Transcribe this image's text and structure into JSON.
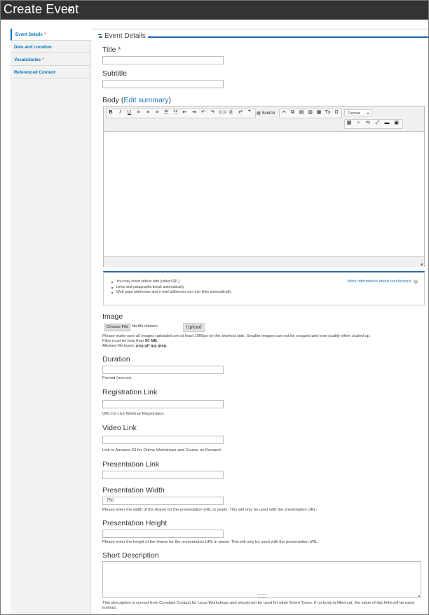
{
  "header": {
    "title": "Create Event",
    "title_icon": "circle-plus-icon"
  },
  "sidebar": {
    "tabs": [
      {
        "label": "Event Details",
        "required": "*"
      },
      {
        "label": "Date and Location",
        "required": ""
      },
      {
        "label": "Vocabularies",
        "required": "*"
      },
      {
        "label": "Referenced Content",
        "required": ""
      }
    ]
  },
  "fieldset": {
    "legend": "Event Details"
  },
  "fields": {
    "title": {
      "label": "Title",
      "required": "*",
      "value": ""
    },
    "subtitle": {
      "label": "Subtitle",
      "value": ""
    },
    "body": {
      "label": "Body",
      "label_open": "(",
      "summary_link": "Edit summary",
      "label_close": ")"
    },
    "editor": {
      "toolbar_buttons": [
        {
          "name": "bold-icon",
          "glyph": "B"
        },
        {
          "name": "italic-icon",
          "glyph": "I"
        },
        {
          "name": "underline-icon",
          "glyph": "U"
        },
        {
          "name": "align-left-icon",
          "glyph": "≡"
        },
        {
          "name": "align-center-icon",
          "glyph": "≡"
        },
        {
          "name": "align-right-icon",
          "glyph": "≡"
        },
        {
          "name": "bulleted-list-icon",
          "glyph": "☰"
        },
        {
          "name": "numbered-list-icon",
          "glyph": "☷"
        },
        {
          "name": "outdent-icon",
          "glyph": "⇤"
        },
        {
          "name": "indent-icon",
          "glyph": "⇥"
        },
        {
          "name": "undo-icon",
          "glyph": "↶"
        },
        {
          "name": "redo-icon",
          "glyph": "↷"
        },
        {
          "name": "link-icon",
          "glyph": "⊂⊃"
        },
        {
          "name": "unlink-icon",
          "glyph": "⊄"
        },
        {
          "name": "superscript-icon",
          "glyph": "x²"
        },
        {
          "name": "blockquote-icon",
          "glyph": "❞"
        }
      ],
      "source_label": "Source",
      "source_icon": "source-icon",
      "toolbar_buttons_2": [
        {
          "name": "cut-icon",
          "glyph": "✂"
        },
        {
          "name": "copy-icon",
          "glyph": "⧉"
        },
        {
          "name": "paste-icon",
          "glyph": "▤"
        },
        {
          "name": "paste-text-icon",
          "glyph": "▥"
        },
        {
          "name": "paste-word-icon",
          "glyph": "▦"
        },
        {
          "name": "remove-format-icon",
          "glyph": "Tx"
        },
        {
          "name": "special-char-icon",
          "glyph": "Ω"
        }
      ],
      "format_label": "Format",
      "toolbar_row2": [
        {
          "name": "table-icon",
          "glyph": "▦"
        },
        {
          "name": "find-icon",
          "glyph": "⌕"
        },
        {
          "name": "replace-icon",
          "glyph": "⇆"
        },
        {
          "name": "maximize-icon",
          "glyph": "⤢"
        },
        {
          "name": "horizontal-rule-icon",
          "glyph": "▬"
        },
        {
          "name": "image-icon",
          "glyph": "▣"
        }
      ]
    },
    "text_format": {
      "tips": [
        "You may insert videos with [video:URL]",
        "Lines and paragraphs break automatically.",
        "Web page addresses and e-mail addresses turn into links automatically."
      ],
      "more_info": "More information about text formats",
      "help_icon": "?"
    },
    "image": {
      "label": "Image",
      "choose_file": "Choose File",
      "no_file": "No file chosen",
      "upload": "Upload",
      "help_1": "Please make sure all images uploaded are at least 1000px on the shortest side. Smaller images can not be cropped and lose quality when scaled up.",
      "help_2_prefix": "Files must be less than ",
      "help_2_value": "50 MB",
      "help_2_suffix": ".",
      "help_3_prefix": "Allowed file types: ",
      "help_3_value": "png gif jpg jpeg",
      "help_3_suffix": "."
    },
    "duration": {
      "label": "Duration",
      "value": "",
      "help": "Format (mm:ss)."
    },
    "registration_link": {
      "label": "Registration Link",
      "value": "",
      "help": "URL for Live Webinar Registration."
    },
    "video_link": {
      "label": "Video Link",
      "value": "",
      "help": "Link to Amazon S3 for Online Workshops and Course on Demand."
    },
    "presentation_link": {
      "label": "Presentation Link",
      "value": ""
    },
    "presentation_width": {
      "label": "Presentation Width",
      "value": "750",
      "help": "Please enter the width of the iframe for the presentation URL in pixels. This will only be used with the presentation URL."
    },
    "presentation_height": {
      "label": "Presentation Height",
      "value": "",
      "help": "Please enter the height of the iframe for the presentation URL in pixels. This will only be used with the presentation URL."
    },
    "short_description": {
      "label": "Short Description",
      "value": "",
      "help": "This description is synced from Constant Contact for Local Workshops and should not be used for other Event Types. If no body is filled out, the value of this field will be used instead."
    }
  },
  "colors": {
    "header_bg": "#333333",
    "accent": "#1c6ab5",
    "link": "#1e75c1",
    "required": "#e0001b"
  }
}
